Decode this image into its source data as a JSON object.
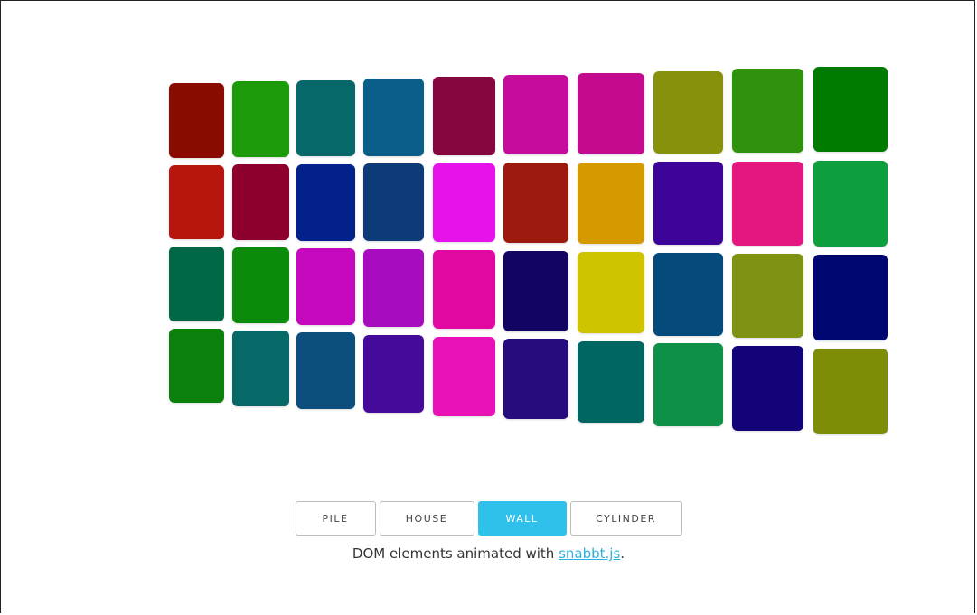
{
  "buttons": [
    {
      "label": "PILE",
      "active": false
    },
    {
      "label": "HOUSE",
      "active": false
    },
    {
      "label": "WALL",
      "active": true
    },
    {
      "label": "CYLINDER",
      "active": false
    }
  ],
  "caption": {
    "prefix": "DOM elements animated with ",
    "link_text": "snabbt.js",
    "suffix": "."
  },
  "tile_colors": [
    [
      "#880d00",
      "#1c9a09",
      "#07686a",
      "#0c5e8a",
      "#860640",
      "#c50c9d",
      "#c40a8f",
      "#87920c",
      "#2f920c",
      "#007b00"
    ],
    [
      "#b6160e",
      "#8c002b",
      "#02218a",
      "#0d3b78",
      "#e711e9",
      "#9d1a0f",
      "#d59a00",
      "#3d0499",
      "#e3177f",
      "#0d9e3d"
    ],
    [
      "#006747",
      "#0c8a0c",
      "#c507bd",
      "#a80cbf",
      "#e107a1",
      "#120463",
      "#cec500",
      "#044b7b",
      "#809212",
      "#010771"
    ],
    [
      "#0c800c",
      "#076868",
      "#0c4f7e",
      "#450a9a",
      "#e912b9",
      "#260c7c",
      "#006661",
      "#0f9048",
      "#130379",
      "#7d8d07"
    ]
  ]
}
